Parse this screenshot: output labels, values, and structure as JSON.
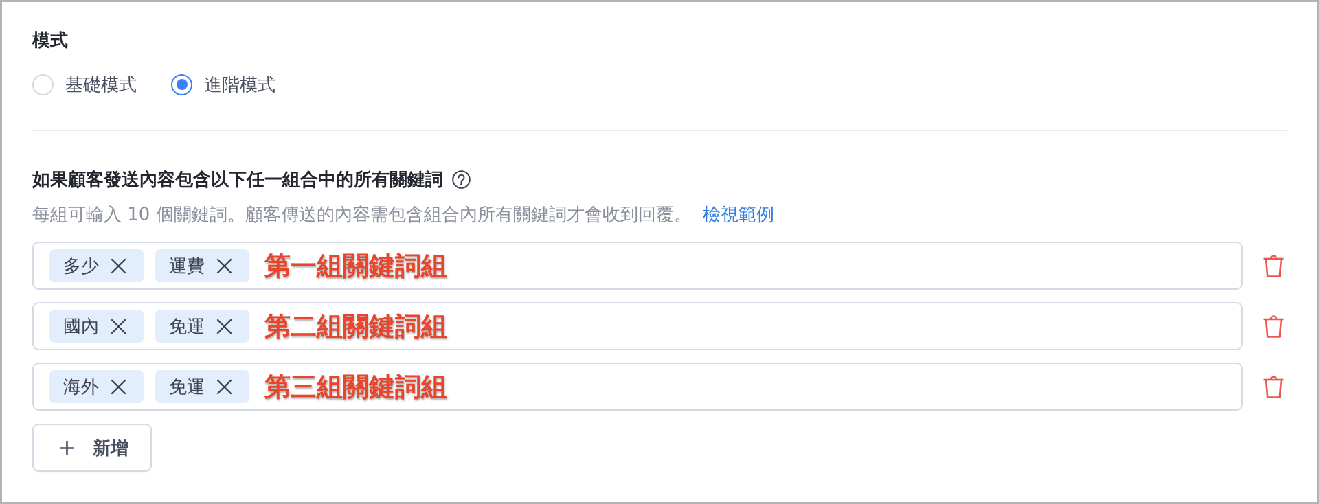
{
  "mode": {
    "title": "模式",
    "options": [
      {
        "label": "基礎模式",
        "selected": false
      },
      {
        "label": "進階模式",
        "selected": true
      }
    ]
  },
  "keywords": {
    "title": "如果顧客發送內容包含以下任一組合中的所有關鍵詞",
    "help": "每組可輸入 10 個關鍵詞。顧客傳送的內容需包含組合內所有關鍵詞才會收到回覆。",
    "link": "檢視範例",
    "groups": [
      {
        "tags": [
          "多少",
          "運費"
        ],
        "annotation": "第一組關鍵詞組"
      },
      {
        "tags": [
          "國內",
          "免運"
        ],
        "annotation": "第二組關鍵詞組"
      },
      {
        "tags": [
          "海外",
          "免運"
        ],
        "annotation": "第三組關鍵詞組"
      }
    ],
    "add_button": "新增"
  }
}
